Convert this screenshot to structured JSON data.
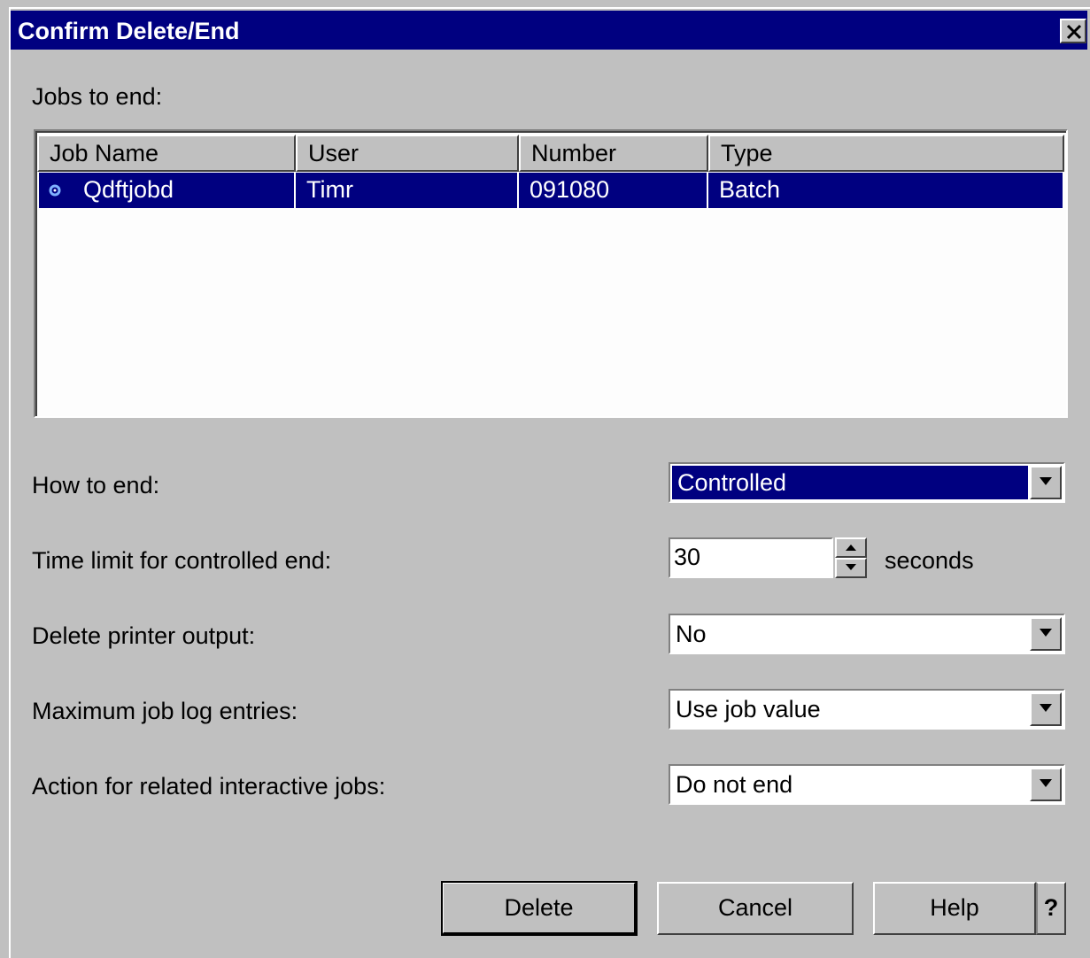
{
  "window": {
    "title": "Confirm Delete/End",
    "close_icon": "close-icon"
  },
  "jobs_label": "Jobs to end:",
  "table": {
    "columns": [
      "Job Name",
      "User",
      "Number",
      "Type"
    ],
    "rows": [
      {
        "job_name": "Qdftjobd",
        "user": "Timr",
        "number": "091080",
        "type": "Batch",
        "icon": "job-icon",
        "selected": true
      }
    ]
  },
  "fields": {
    "how_to_end": {
      "label": "How to end:",
      "value": "Controlled"
    },
    "time_limit": {
      "label": "Time limit for controlled end:",
      "value": "30",
      "unit": "seconds"
    },
    "delete_printer_output": {
      "label": "Delete printer output:",
      "value": "No"
    },
    "max_job_log_entries": {
      "label": "Maximum job log entries:",
      "value": "Use job value"
    },
    "related_interactive_jobs": {
      "label": "Action for related interactive jobs:",
      "value": "Do not end"
    }
  },
  "buttons": {
    "delete": "Delete",
    "cancel": "Cancel",
    "help": "Help",
    "help_q": "?"
  },
  "colors": {
    "title_bar": "#000080",
    "selection": "#000080",
    "face": "#c0c0c0"
  }
}
